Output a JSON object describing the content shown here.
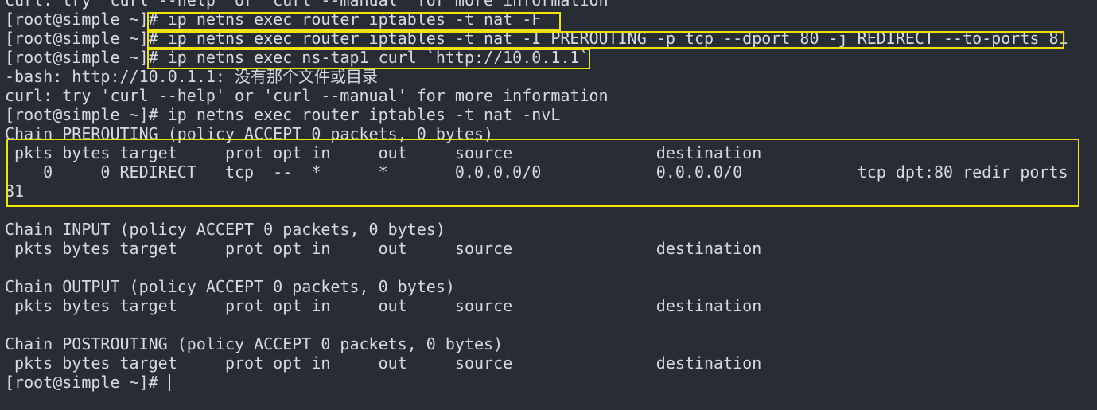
{
  "terminal": {
    "colors": {
      "background": "#282c34",
      "text": "#d7dae0",
      "highlight": "#f2e400"
    },
    "lines": [
      "curl: try 'curl --help' or 'curl --manual' for more information",
      "[root@simple ~]# ip netns exec router iptables -t nat -F",
      "[root@simple ~]# ip netns exec router iptables -t nat -I PREROUTING -p tcp --dport 80 -j REDIRECT --to-ports 81",
      "[root@simple ~]# ip netns exec ns-tap1 curl `http://10.0.1.1`",
      "-bash: http://10.0.1.1: 没有那个文件或目录",
      "curl: try 'curl --help' or 'curl --manual' for more information",
      "[root@simple ~]# ip netns exec router iptables -t nat -nvL",
      "Chain PREROUTING (policy ACCEPT 0 packets, 0 bytes)",
      " pkts bytes target     prot opt in     out     source               destination",
      "    0     0 REDIRECT   tcp  --  *      *       0.0.0.0/0            0.0.0.0/0            tcp dpt:80 redir ports",
      "81",
      "",
      "Chain INPUT (policy ACCEPT 0 packets, 0 bytes)",
      " pkts bytes target     prot opt in     out     source               destination",
      "",
      "Chain OUTPUT (policy ACCEPT 0 packets, 0 bytes)",
      " pkts bytes target     prot opt in     out     source               destination",
      "",
      "Chain POSTROUTING (policy ACCEPT 0 packets, 0 bytes)",
      " pkts bytes target     prot opt in     out     source               destination",
      "[root@simple ~]# "
    ]
  }
}
